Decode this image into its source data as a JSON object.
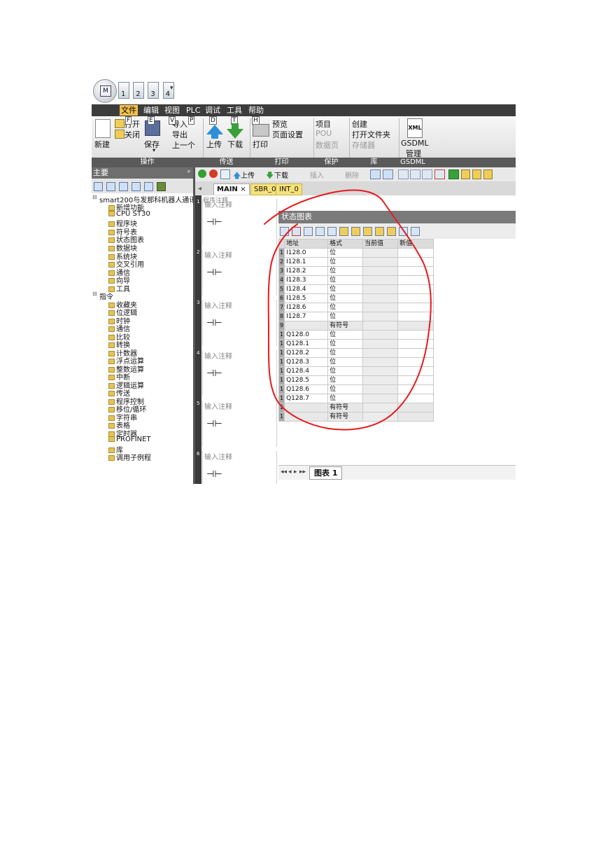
{
  "qat": {
    "doc_keys": [
      "1",
      "2",
      "3",
      "4"
    ],
    "dropdown_glyph": "▾"
  },
  "menu": {
    "items": [
      "文件",
      "编辑",
      "视图",
      "PLC",
      "调试",
      "工具",
      "帮助"
    ],
    "active": "文件"
  },
  "ribbon": {
    "new": "新建",
    "open": "打开",
    "close": "关闭",
    "save": "保存",
    "import": "导入",
    "export": "导出",
    "previous": "上一个",
    "upload": "上传",
    "download": "下载",
    "print": "打印",
    "preview": "预览",
    "page_setup": "页面设置",
    "project": "项目",
    "pou": "POU",
    "data_page": "数据页",
    "create": "创建",
    "open_folder": "打开文件夹",
    "memory_card": "存储器",
    "gsdml": "GSDML",
    "manage": "管理",
    "keytips": {
      "open": "F",
      "close": "E",
      "import": "V",
      "import2": "P",
      "upload": "D",
      "download": "T",
      "print": "H"
    },
    "groups": [
      "操作",
      "传送",
      "打印",
      "保护",
      "库",
      "GSDML"
    ]
  },
  "left_panel": {
    "title": "主要",
    "pin": "ᵖ",
    "tree": [
      {
        "label": "smart200与发那科机器人通讯 (C"
      },
      {
        "label": "新增功能"
      },
      {
        "label": "CPU ST30"
      },
      {
        "label": "程序块"
      },
      {
        "label": "符号表"
      },
      {
        "label": "状态图表"
      },
      {
        "label": "数据块"
      },
      {
        "label": "系统块"
      },
      {
        "label": "交叉引用"
      },
      {
        "label": "通信"
      },
      {
        "label": "向导"
      },
      {
        "label": "工具"
      },
      {
        "label": "指令"
      },
      {
        "label": "收藏夹"
      },
      {
        "label": "位逻辑"
      },
      {
        "label": "时钟"
      },
      {
        "label": "通信"
      },
      {
        "label": "比较"
      },
      {
        "label": "转换"
      },
      {
        "label": "计数器"
      },
      {
        "label": "浮点运算"
      },
      {
        "label": "整数运算"
      },
      {
        "label": "中断"
      },
      {
        "label": "逻辑运算"
      },
      {
        "label": "传送"
      },
      {
        "label": "程序控制"
      },
      {
        "label": "移位/循环"
      },
      {
        "label": "字符串"
      },
      {
        "label": "表格"
      },
      {
        "label": "定时器"
      },
      {
        "label": "PROFINET"
      },
      {
        "label": "库"
      },
      {
        "label": "调用子例程"
      }
    ]
  },
  "editor_toolbar": {
    "upload": "上传",
    "download": "下载",
    "insert": "插入",
    "delete": "删除"
  },
  "editor_tabs": {
    "prev": "◂",
    "main": "MAIN",
    "close": "×",
    "sbr": "SBR_0",
    "int": "INT_0"
  },
  "editor": {
    "header_comment": "程序注释",
    "networks": [
      {
        "num": "1",
        "comment": "输入注释",
        "contact": "⊣⊢"
      },
      {
        "num": "2",
        "comment": "输入注释",
        "contact": "⊣⊢"
      },
      {
        "num": "3",
        "comment": "输入注释",
        "contact": "⊣⊢"
      },
      {
        "num": "4",
        "comment": "输入注释",
        "contact": "⊣⊢"
      },
      {
        "num": "5",
        "comment": "输入注释",
        "contact": "⊣⊢"
      },
      {
        "num": "6",
        "comment": "输入注释",
        "contact": "⊣⊢"
      }
    ]
  },
  "status_chart": {
    "title": "状态图表",
    "columns": [
      "",
      "地址",
      "格式",
      "当前值",
      "新值"
    ],
    "rows": [
      {
        "n": "1",
        "addr": "I128.0",
        "fmt": "位"
      },
      {
        "n": "2",
        "addr": "I128.1",
        "fmt": "位"
      },
      {
        "n": "3",
        "addr": "I128.2",
        "fmt": "位"
      },
      {
        "n": "4",
        "addr": "I128.3",
        "fmt": "位"
      },
      {
        "n": "5",
        "addr": "I128.4",
        "fmt": "位"
      },
      {
        "n": "6",
        "addr": "I128.5",
        "fmt": "位"
      },
      {
        "n": "7",
        "addr": "I128.6",
        "fmt": "位"
      },
      {
        "n": "8",
        "addr": "I128.7",
        "fmt": "位"
      },
      {
        "n": "9",
        "addr": "",
        "fmt": "有符号"
      },
      {
        "n": "1",
        "addr": "Q128.0",
        "fmt": "位"
      },
      {
        "n": "1",
        "addr": "Q128.1",
        "fmt": "位"
      },
      {
        "n": "1",
        "addr": "Q128.2",
        "fmt": "位"
      },
      {
        "n": "1",
        "addr": "Q128.3",
        "fmt": "位"
      },
      {
        "n": "1",
        "addr": "Q128.4",
        "fmt": "位"
      },
      {
        "n": "1",
        "addr": "Q128.5",
        "fmt": "位"
      },
      {
        "n": "1",
        "addr": "Q128.6",
        "fmt": "位"
      },
      {
        "n": "1",
        "addr": "Q128.7",
        "fmt": "位"
      },
      {
        "n": "1",
        "addr": "",
        "fmt": "有符号"
      },
      {
        "n": "1",
        "addr": "",
        "fmt": "有符号"
      }
    ],
    "sheet_nav": [
      "◂◂",
      "◂",
      "▸",
      "▸▸"
    ],
    "sheet_tab": "图表 1"
  },
  "annotation": {
    "color": "#e8191c"
  }
}
